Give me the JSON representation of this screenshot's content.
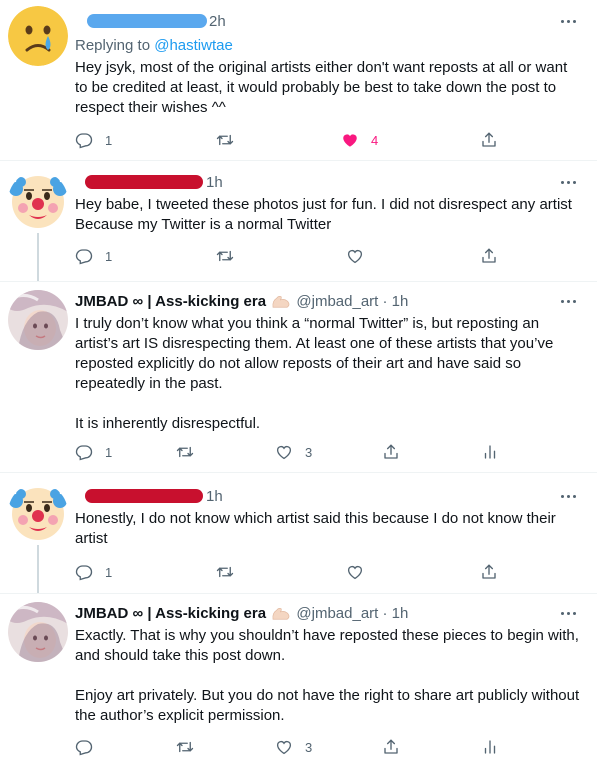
{
  "tweets": [
    {
      "time": "2h",
      "replying_label": "Replying to ",
      "replying_to": "@hastiwtae",
      "text": "Hey jsyk, most of the original artists either don't want reposts at all or want to be credited at least, it would probably be best to take down the post to respect their wishes ^^",
      "replies": "1",
      "likes": "4"
    },
    {
      "time": "1h",
      "text": "Hey babe, I tweeted these photos just for fun.  I did not disrespect any artist Because my Twitter is a normal Twitter",
      "replies": "1"
    },
    {
      "name": "JMBAD ∞ | Ass-kicking era",
      "handle": "@jmbad_art",
      "time": "· 1h",
      "text": "I truly don’t know what you think a “normal Twitter” is, but reposting an artist’s art IS disrespecting them. At least one of these artists that you’ve reposted explicitly do not allow reposts of their art and have said so repeatedly in the past.\n\nIt is inherently disrespectful.",
      "replies": "1",
      "likes": "3"
    },
    {
      "time": "1h",
      "text": "Honestly, I do not know which artist said this because I do not know their artist",
      "replies": "1"
    },
    {
      "name": "JMBAD ∞ | Ass-kicking era",
      "handle": "@jmbad_art",
      "time": "· 1h",
      "text": "Exactly. That is why you shouldn’t have reposted these pieces to begin with, and should take this post down.\n\nEnjoy art privately. But you do not have the right to share art publicly without the author’s explicit permission.",
      "likes": "3"
    }
  ],
  "colors": {
    "redact_blue": "#5aa8ee",
    "redact_red": "#c8102e",
    "like_pink": "#f91880",
    "icon_gray": "#536471"
  }
}
